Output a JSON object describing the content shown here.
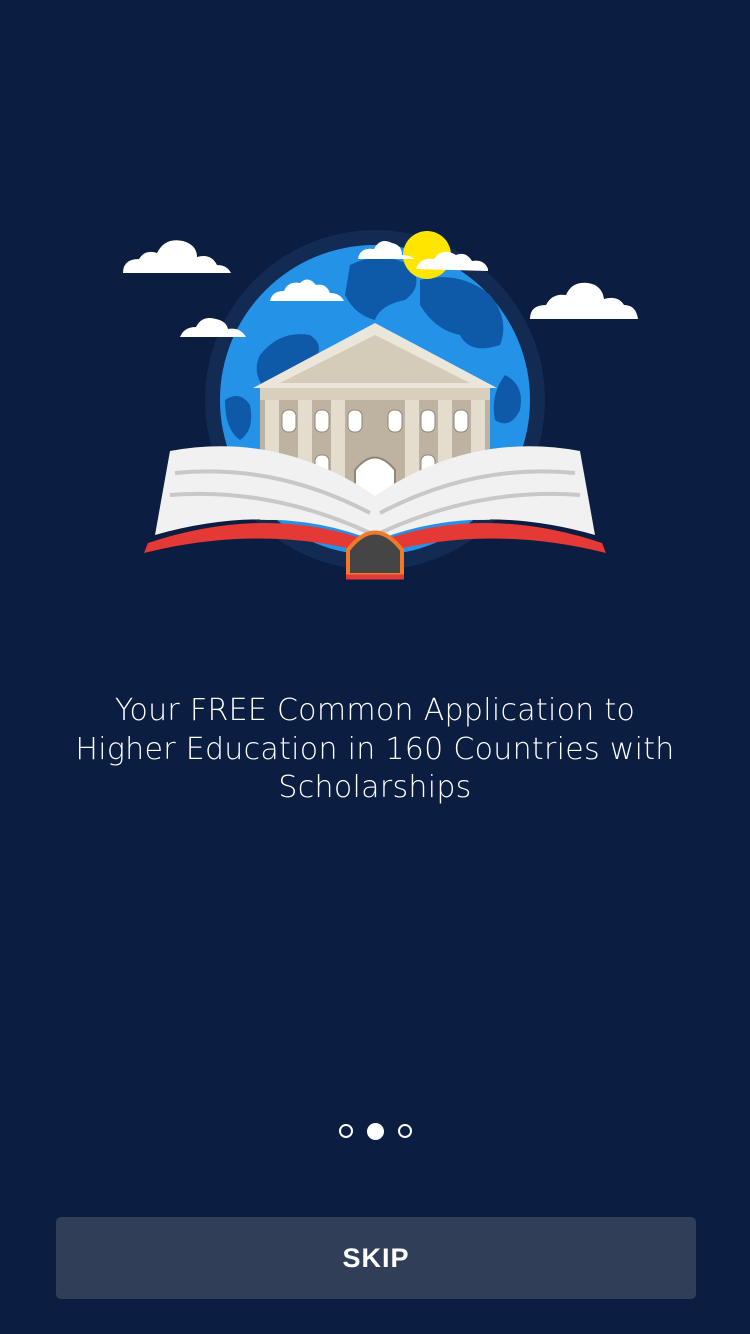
{
  "onboarding": {
    "tagline": "Your FREE Common Application to Higher Education in 160 Countries with Scholarships",
    "illustration": "globe-book-university-illustration"
  },
  "pager": {
    "total": 3,
    "active_index": 1
  },
  "actions": {
    "skip_label": "SKIP"
  },
  "colors": {
    "background": "#0b1d40",
    "button": "#313e58",
    "globe": "#1f8fe0",
    "sun": "#ffe600",
    "book_cover": "#e53935"
  }
}
